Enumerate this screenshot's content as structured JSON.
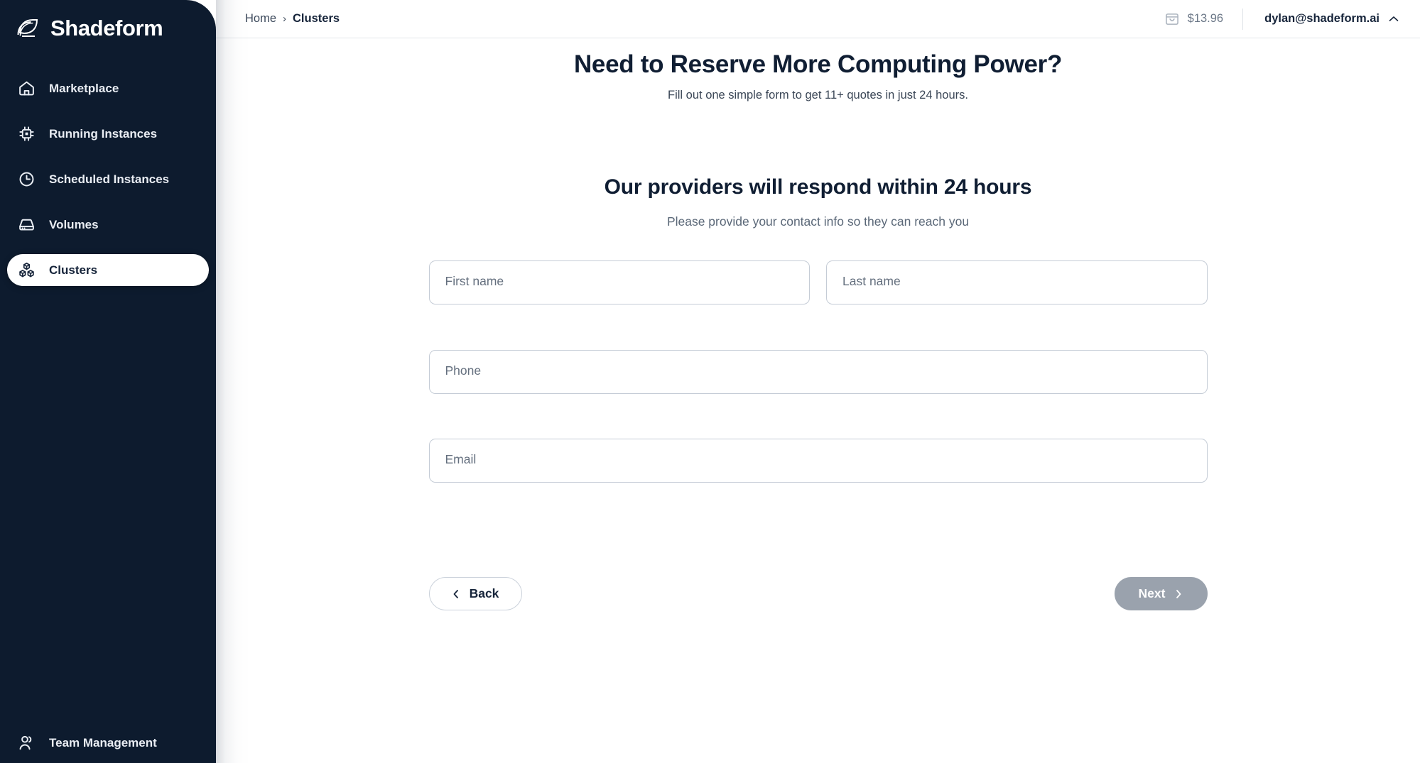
{
  "brand": {
    "name": "Shadeform",
    "logo_icon": "shadeform-logo-icon",
    "sidebar_color": "#0d1b2e"
  },
  "sidebar": {
    "items": [
      {
        "label": "Marketplace",
        "icon": "home-icon",
        "active": false
      },
      {
        "label": "Running Instances",
        "icon": "cpu-chip-icon",
        "active": false
      },
      {
        "label": "Scheduled Instances",
        "icon": "clock-icon",
        "active": false
      },
      {
        "label": "Volumes",
        "icon": "hard-drive-icon",
        "active": false
      },
      {
        "label": "Clusters",
        "icon": "clusters-icon",
        "active": true
      }
    ],
    "bottom_items": [
      {
        "label": "Team Management",
        "icon": "users-icon",
        "active": false
      }
    ]
  },
  "header": {
    "breadcrumb": {
      "home": "Home",
      "separator": "›",
      "current": "Clusters"
    },
    "balance": {
      "icon": "archive-box-icon",
      "amount": "$13.96"
    },
    "account": {
      "email": "dylan@shadeform.ai",
      "caret_icon": "chevron-up-icon"
    }
  },
  "main": {
    "page_title": "Need to Reserve More Computing Power?",
    "page_subtitle": "Fill out one simple form to get 11+ quotes in just 24 hours.",
    "section_title": "Our providers will respond within 24 hours",
    "section_subtitle": "Please provide your contact info so they can reach you",
    "form": {
      "first_name": {
        "placeholder": "First name",
        "value": ""
      },
      "last_name": {
        "placeholder": "Last name",
        "value": ""
      },
      "phone": {
        "placeholder": "Phone",
        "value": ""
      },
      "email": {
        "placeholder": "Email",
        "value": ""
      }
    },
    "footer": {
      "back": {
        "label": "Back",
        "icon": "chevron-left-icon",
        "disabled": false
      },
      "next": {
        "label": "Next",
        "icon": "chevron-right-icon",
        "disabled": true
      }
    }
  }
}
